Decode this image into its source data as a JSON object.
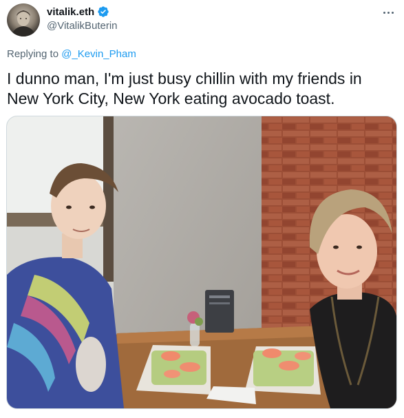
{
  "author": {
    "display_name": "vitalik.eth",
    "handle": "@VitalikButerin",
    "verified": true,
    "avatar_icon": "profile-photo"
  },
  "menu": {
    "icon": "more-horizontal-icon"
  },
  "reply": {
    "prefix": "Replying to ",
    "to_handle": "@_Kevin_Pham"
  },
  "tweet": {
    "text": "I dunno man, I'm just busy chillin with my friends in New York City, New York eating avocado toast."
  },
  "colors": {
    "link": "#1d9bf0",
    "verified": "#1d9bf0",
    "muted": "#536471",
    "text": "#0f1419"
  }
}
